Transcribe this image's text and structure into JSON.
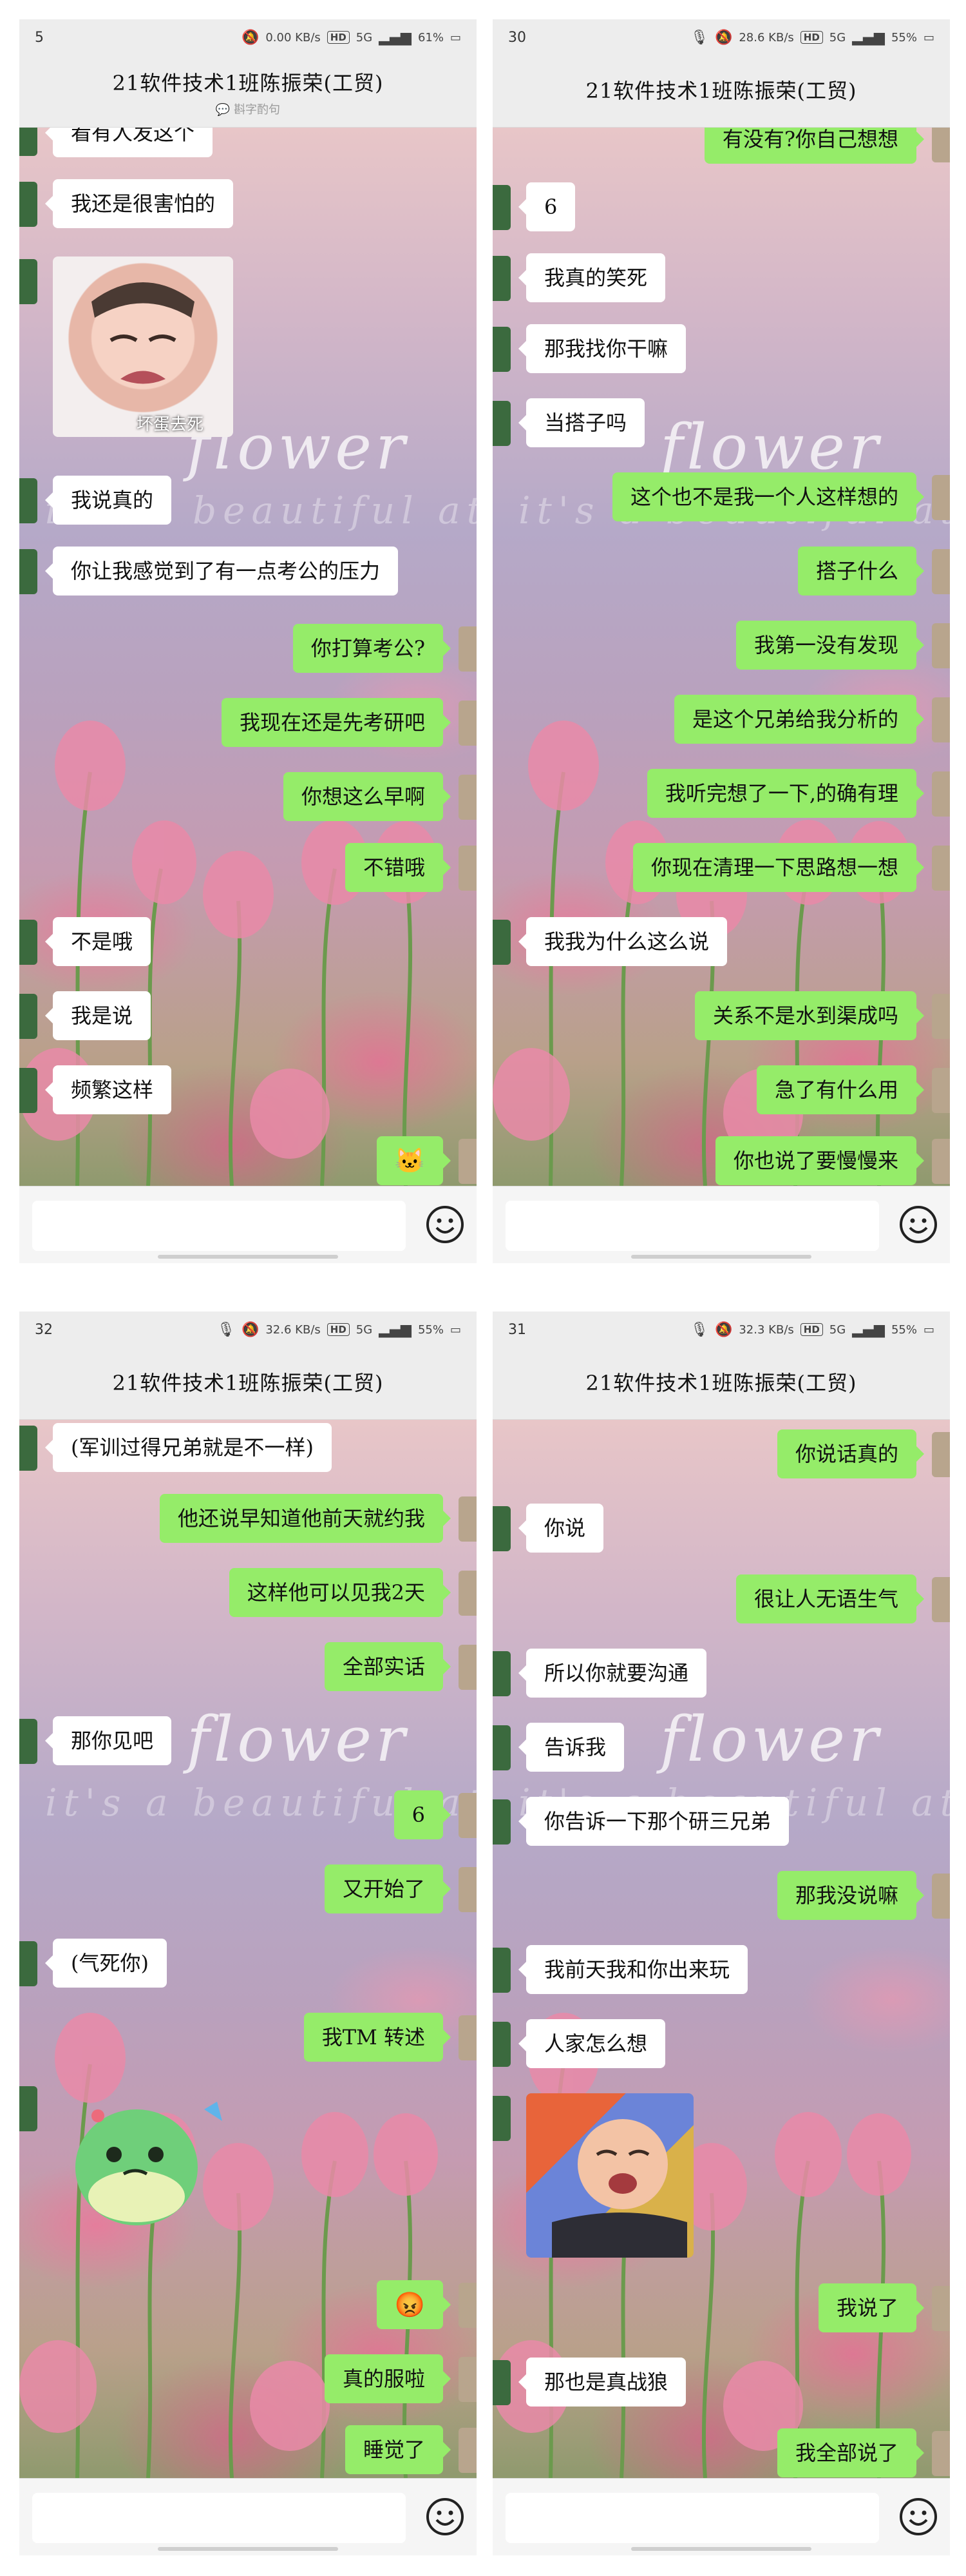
{
  "panels": [
    {
      "status": {
        "time": "5",
        "battery": "61%",
        "speed": "0.00",
        "speed_unit": "KB/s",
        "net": "5G"
      },
      "title": "21软件技术1班陈振荣(工贸)",
      "subtitle": "斟字酌句",
      "sticker_caption": "坏蛋去死",
      "messages": [
        {
          "side": "left",
          "text": "看有人发这个"
        },
        {
          "side": "left",
          "text": "我还是很害怕的"
        },
        {
          "side": "left",
          "text": "我说真的"
        },
        {
          "side": "left",
          "text": "你让我感觉到了有一点考公的压力"
        },
        {
          "side": "right",
          "text": "你打算考公?"
        },
        {
          "side": "right",
          "text": "我现在还是先考研吧"
        },
        {
          "side": "right",
          "text": "你想这么早啊"
        },
        {
          "side": "right",
          "text": "不错哦"
        },
        {
          "side": "left",
          "text": "不是哦"
        },
        {
          "side": "left",
          "text": "我是说"
        },
        {
          "side": "left",
          "text": "频繁这样"
        }
      ]
    },
    {
      "status": {
        "time": "30",
        "battery": "55%",
        "speed": "28.6",
        "speed_unit": "KB/s",
        "net": "5G"
      },
      "title": "21软件技术1班陈振荣(工贸)",
      "messages": [
        {
          "side": "right",
          "text": "有没有?你自己想想"
        },
        {
          "side": "left",
          "text": "6"
        },
        {
          "side": "left",
          "text": "我真的笑死"
        },
        {
          "side": "left",
          "text": "那我找你干嘛"
        },
        {
          "side": "left",
          "text": "当搭子吗"
        },
        {
          "side": "right",
          "text": "这个也不是我一个人这样想的"
        },
        {
          "side": "right",
          "text": "搭子什么"
        },
        {
          "side": "right",
          "text": "我第一没有发现"
        },
        {
          "side": "right",
          "text": "是这个兄弟给我分析的"
        },
        {
          "side": "right",
          "text": "我听完想了一下,的确有理"
        },
        {
          "side": "right",
          "text": "你现在清理一下思路想一想"
        },
        {
          "side": "left",
          "text": "我我为什么这么说"
        },
        {
          "side": "right",
          "text": "关系不是水到渠成吗"
        },
        {
          "side": "right",
          "text": "急了有什么用"
        },
        {
          "side": "right",
          "text": "你也说了要慢慢来"
        }
      ]
    },
    {
      "status": {
        "time": "32",
        "battery": "55%",
        "speed": "32.6",
        "speed_unit": "KB/s",
        "net": "5G"
      },
      "title": "21软件技术1班陈振荣(工贸)",
      "messages": [
        {
          "side": "left",
          "text": "(军训过得兄弟就是不一样)"
        },
        {
          "side": "right",
          "text": "他还说早知道他前天就约我"
        },
        {
          "side": "right",
          "text": "这样他可以见我2天"
        },
        {
          "side": "right",
          "text": "全部实话"
        },
        {
          "side": "left",
          "text": "那你见吧"
        },
        {
          "side": "right",
          "text": "6"
        },
        {
          "side": "right",
          "text": "又开始了"
        },
        {
          "side": "left",
          "text": "(气死你)"
        },
        {
          "side": "right",
          "text": "我TM 转述"
        },
        {
          "side": "right",
          "text": "真的服啦"
        },
        {
          "side": "right",
          "text": "睡觉了"
        }
      ]
    },
    {
      "status": {
        "time": "31",
        "battery": "55%",
        "speed": "32.3",
        "speed_unit": "KB/s",
        "net": "5G"
      },
      "title": "21软件技术1班陈振荣(工贸)",
      "messages": [
        {
          "side": "right",
          "text": "你说话真的"
        },
        {
          "side": "left",
          "text": "你说"
        },
        {
          "side": "right",
          "text": "很让人无语生气"
        },
        {
          "side": "left",
          "text": "所以你就要沟通"
        },
        {
          "side": "left",
          "text": "告诉我"
        },
        {
          "side": "left",
          "text": "你告诉一下那个研三兄弟"
        },
        {
          "side": "right",
          "text": "那我没说嘛"
        },
        {
          "side": "left",
          "text": "我前天我和你出来玩"
        },
        {
          "side": "left",
          "text": "人家怎么想"
        },
        {
          "side": "right",
          "text": "我说了"
        },
        {
          "side": "left",
          "text": "那也是真战狼"
        },
        {
          "side": "right",
          "text": "我全部说了"
        }
      ]
    }
  ],
  "watermark": {
    "word": "flower",
    "phrase": "it's a beautiful at"
  },
  "colors": {
    "right_bubble": "#95ec69",
    "left_bubble": "#ffffff",
    "bar": "#ededed"
  },
  "icons": [
    "mute-icon",
    "notification-icon",
    "hd-icon",
    "signal-5g-icon",
    "battery-icon",
    "smiley-icon",
    "cat-emoji-icon",
    "angry-emoji-icon"
  ]
}
